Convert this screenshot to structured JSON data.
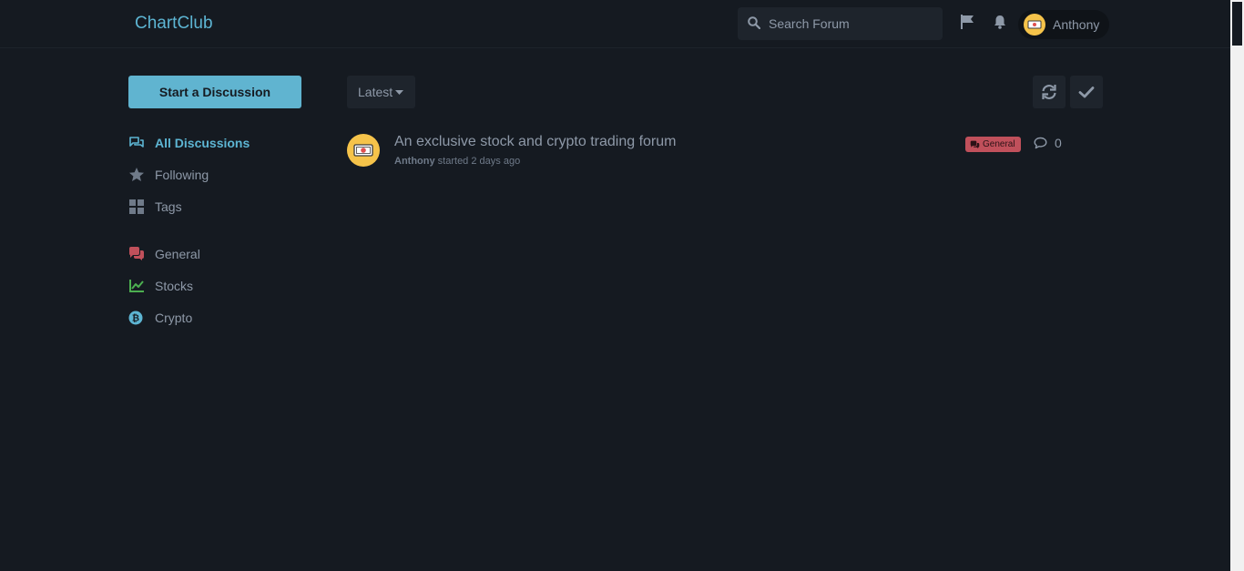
{
  "header": {
    "brand": "ChartClub",
    "search_placeholder": "Search Forum",
    "user_name": "Anthony"
  },
  "sidebar": {
    "start_button": "Start a Discussion",
    "nav": [
      {
        "label": "All Discussions",
        "icon": "comments-icon",
        "active": true
      },
      {
        "label": "Following",
        "icon": "star-icon"
      },
      {
        "label": "Tags",
        "icon": "grid-icon"
      }
    ],
    "tags": [
      {
        "label": "General",
        "icon": "comments-icon",
        "color": "#c0505b"
      },
      {
        "label": "Stocks",
        "icon": "chart-line-icon",
        "color": "#4caf50"
      },
      {
        "label": "Crypto",
        "icon": "bitcoin-icon",
        "color": "#5db5d3"
      }
    ]
  },
  "toolbar": {
    "sort_label": "Latest",
    "refresh_icon": "refresh-icon",
    "mark_read_icon": "check-icon"
  },
  "discussions": [
    {
      "title": "An exclusive stock and crypto trading forum",
      "author": "Anthony",
      "started_text": "started",
      "time": "2 days ago",
      "tag": "General",
      "tag_color": "#c0505b",
      "reply_count": "0"
    }
  ],
  "colors": {
    "background": "#151a21",
    "accent": "#5db5d3",
    "button": "#60b4d0",
    "avatar": "#f5c34a"
  }
}
